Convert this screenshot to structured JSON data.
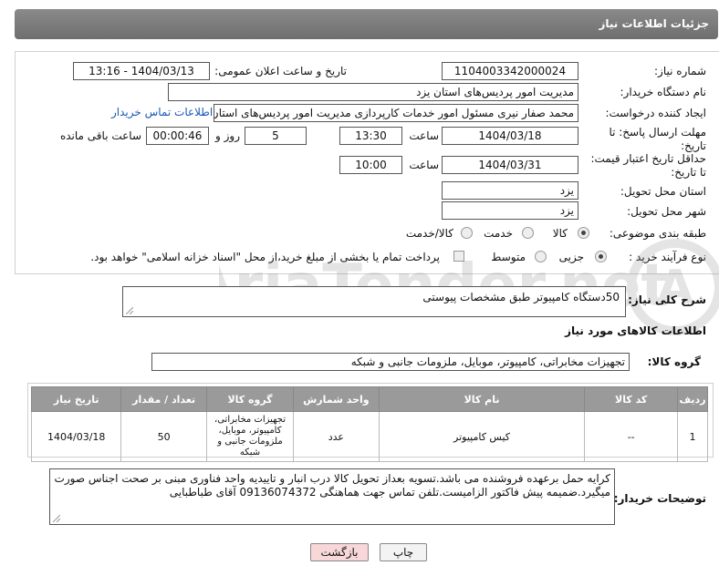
{
  "header": {
    "title": "جزئیات اطلاعات نیاز"
  },
  "form": {
    "need_number_label": "شماره نیاز:",
    "need_number": "1104003342000024",
    "announce_label": "تاریخ و ساعت اعلان عمومی:",
    "announce_value": "1404/03/13 - 13:16",
    "buyer_org_label": "نام دستگاه خریدار:",
    "buyer_org": "مدیریت امور پردیس‌های استان یزد",
    "creator_label": "ایجاد کننده درخواست:",
    "creator": "محمد  صفار نیری مسئول امور خدمات کارپردازی مدیریت امور پردیس‌های استان",
    "contact_link": "اطلاعات تماس خریدار",
    "deadline_label": "مهلت ارسال پاسخ: تا تاریخ:",
    "deadline_date": "1404/03/18",
    "time_label": "ساعت",
    "deadline_time": "13:30",
    "days_value": "5",
    "days_label": "روز و",
    "remaining_time": "00:00:46",
    "remaining_label": "ساعت باقی مانده",
    "min_price_label": "حداقل تاریخ اعتبار قیمت: تا تاریخ:",
    "min_price_date": "1404/03/31",
    "min_price_time": "10:00",
    "province_label": "استان محل تحویل:",
    "province": "یزد",
    "city_label": "شهر محل تحویل:",
    "city": "یزد",
    "category_label": "طبقه بندی موضوعی:",
    "category_options": [
      "کالا",
      "خدمت",
      "کالا/خدمت"
    ],
    "category_selected": "کالا",
    "process_label": "نوع فرآیند خرید :",
    "process_options": [
      "جزیی",
      "متوسط"
    ],
    "process_selected": "جزیی",
    "payment_note": "پرداخت تمام یا بخشی از مبلغ خرید،از محل \"اسناد خزانه اسلامی\" خواهد بود."
  },
  "summary": {
    "label": "شرح کلی نیاز:",
    "value": "50دستگاه کامپیوتر طبق مشخصات پیوستی"
  },
  "goods_section": {
    "title": "اطلاعات کالاهای مورد نیاز",
    "group_label": "گروه کالا:",
    "group_value": "تجهیزات مخابراتی، کامپیوتر، موبایل، ملزومات جانبی و شبکه"
  },
  "table": {
    "headers": [
      "ردیف",
      "کد کالا",
      "نام کالا",
      "واحد شمارش",
      "گروه کالا",
      "تعداد / مقدار",
      "تاریخ نیاز"
    ],
    "rows": [
      [
        "1",
        "--",
        "کیس کامپیوتر",
        "عدد",
        "تجهیزات مخابراتی، کامپیوتر، موبایل، ملزومات جانبی و شبکه",
        "50",
        "1404/03/18"
      ]
    ]
  },
  "buyer_notes": {
    "label": "توضیحات خریدار:",
    "value": "کرایه حمل برعهده فروشنده می باشد.تسویه بعداز تحویل کالا درب انبار و تاییدیه واحد فناوری مبنی بر صحت اجناس صورت میگیرد.ضمیمه پیش فاکتور الزامیست.تلفن تماس جهت هماهنگی 09136074372 آقای طباطبایی"
  },
  "buttons": {
    "print": "چاپ",
    "back": "بازگشت"
  },
  "colors": {
    "header_bg": "#7a7a7a",
    "link": "#1a58b8",
    "back_button_bg": "#f7d7d7"
  }
}
